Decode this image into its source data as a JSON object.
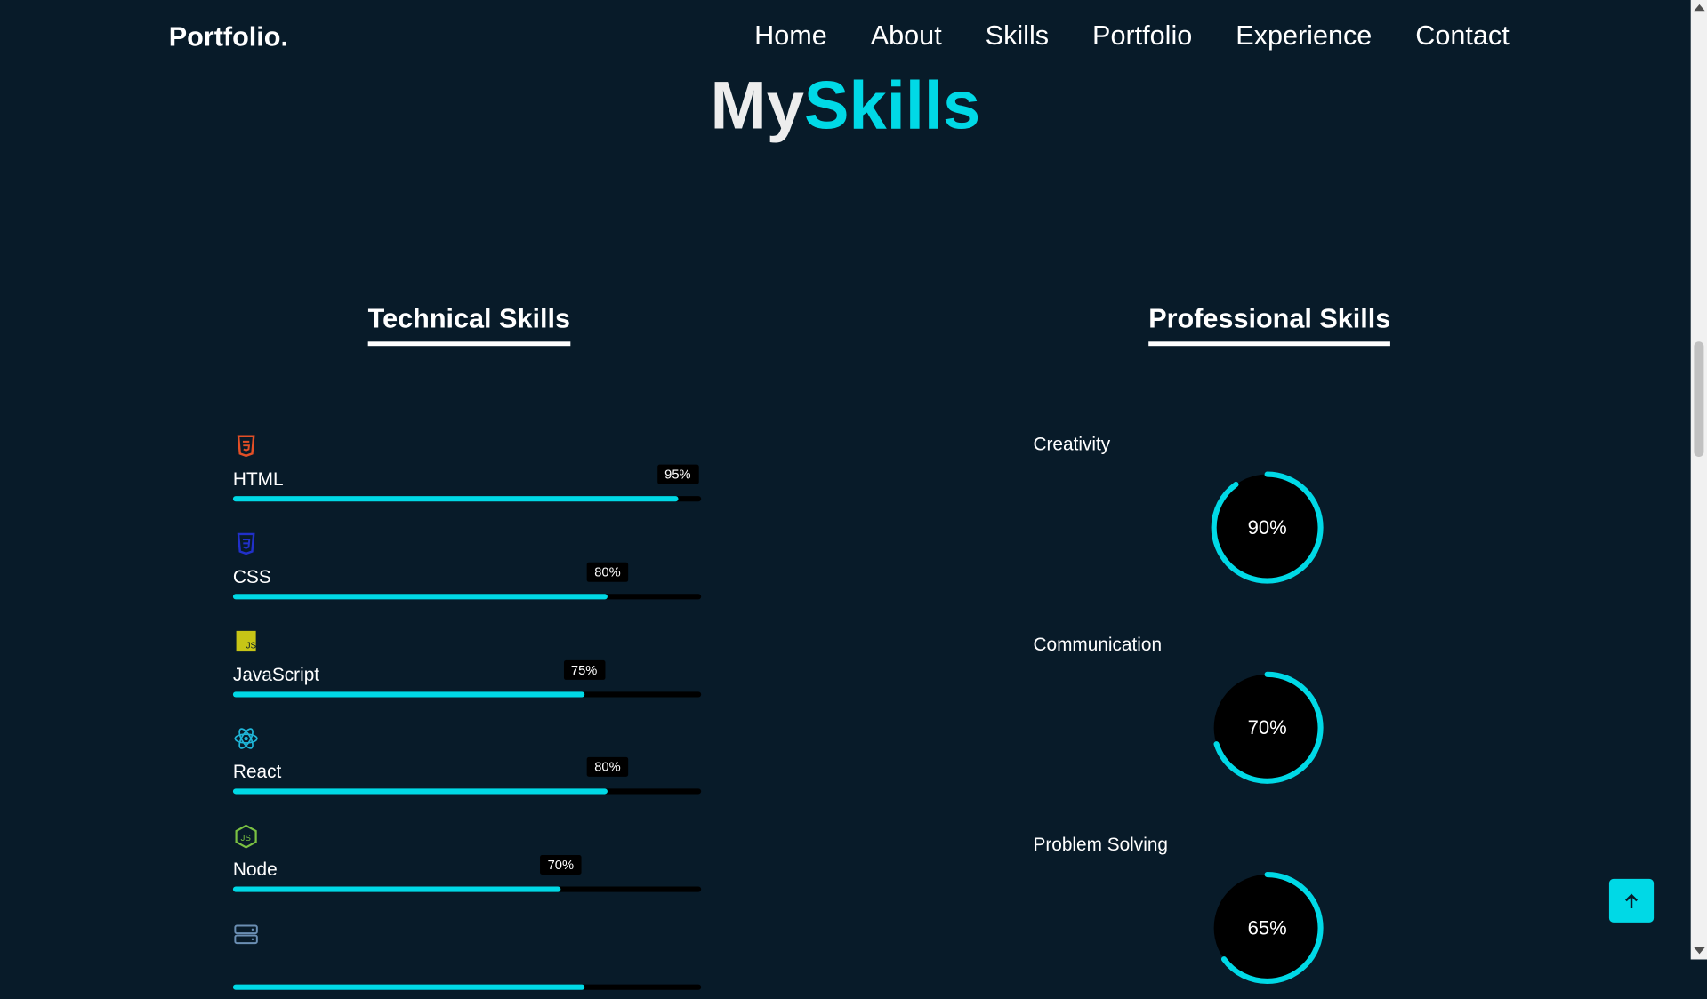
{
  "header": {
    "logo": "Portfolio.",
    "nav": [
      "Home",
      "About",
      "Skills",
      "Portfolio",
      "Experience",
      "Contact"
    ]
  },
  "page": {
    "title_part1": "My",
    "title_part2": "Skills"
  },
  "technical": {
    "heading": "Technical Skills",
    "skills": [
      {
        "name": "HTML",
        "percent_label": "95%",
        "percent": 95,
        "icon": "html5-icon",
        "color": "#e34f26"
      },
      {
        "name": "CSS",
        "percent_label": "80%",
        "percent": 80,
        "icon": "css3-icon",
        "color": "#2130c9"
      },
      {
        "name": "JavaScript",
        "percent_label": "75%",
        "percent": 75,
        "icon": "javascript-icon",
        "color": "#c7c516"
      },
      {
        "name": "React",
        "percent_label": "80%",
        "percent": 80,
        "icon": "react-icon",
        "color": "#1fb6d8"
      },
      {
        "name": "Node",
        "percent_label": "70%",
        "percent": 70,
        "icon": "nodejs-icon",
        "color": "#7ac142"
      },
      {
        "name": "",
        "percent_label": "",
        "percent": 75,
        "icon": "database-server-icon",
        "color": "#6b8fb3"
      }
    ]
  },
  "professional": {
    "heading": "Professional Skills",
    "skills": [
      {
        "name": "Creativity",
        "percent_label": "90%",
        "percent": 90
      },
      {
        "name": "Communication",
        "percent_label": "70%",
        "percent": 70
      },
      {
        "name": "Problem Solving",
        "percent_label": "65%",
        "percent": 65
      }
    ]
  },
  "colors": {
    "background": "#081b29",
    "accent": "#00d9e6"
  }
}
